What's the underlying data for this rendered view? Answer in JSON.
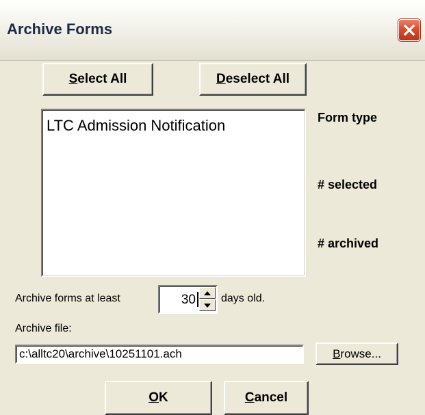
{
  "window": {
    "title": "Archive Forms",
    "close_icon": "close-x-icon",
    "accent_color": "#D84F2F"
  },
  "buttons": {
    "select_all": {
      "mnemonic": "S",
      "rest": "elect All"
    },
    "deselect_all": {
      "mnemonic": "D",
      "rest": "eselect All"
    },
    "browse": {
      "mnemonic": "B",
      "rest": "rowse..."
    },
    "ok": {
      "mnemonic": "O",
      "rest": "K"
    },
    "cancel": {
      "mnemonic": "C",
      "rest": "ancel"
    }
  },
  "form_list": {
    "items": [
      "LTC Admission Notification"
    ]
  },
  "side_labels": {
    "form_type": "Form type",
    "selected": "# selected",
    "archived": "# archived"
  },
  "age": {
    "label_before": "Archive forms at least",
    "value": "30",
    "label_after": "days old."
  },
  "archive_file": {
    "label": "Archive file:",
    "value": "c:\\alltc20\\archive\\10251101.ach"
  }
}
